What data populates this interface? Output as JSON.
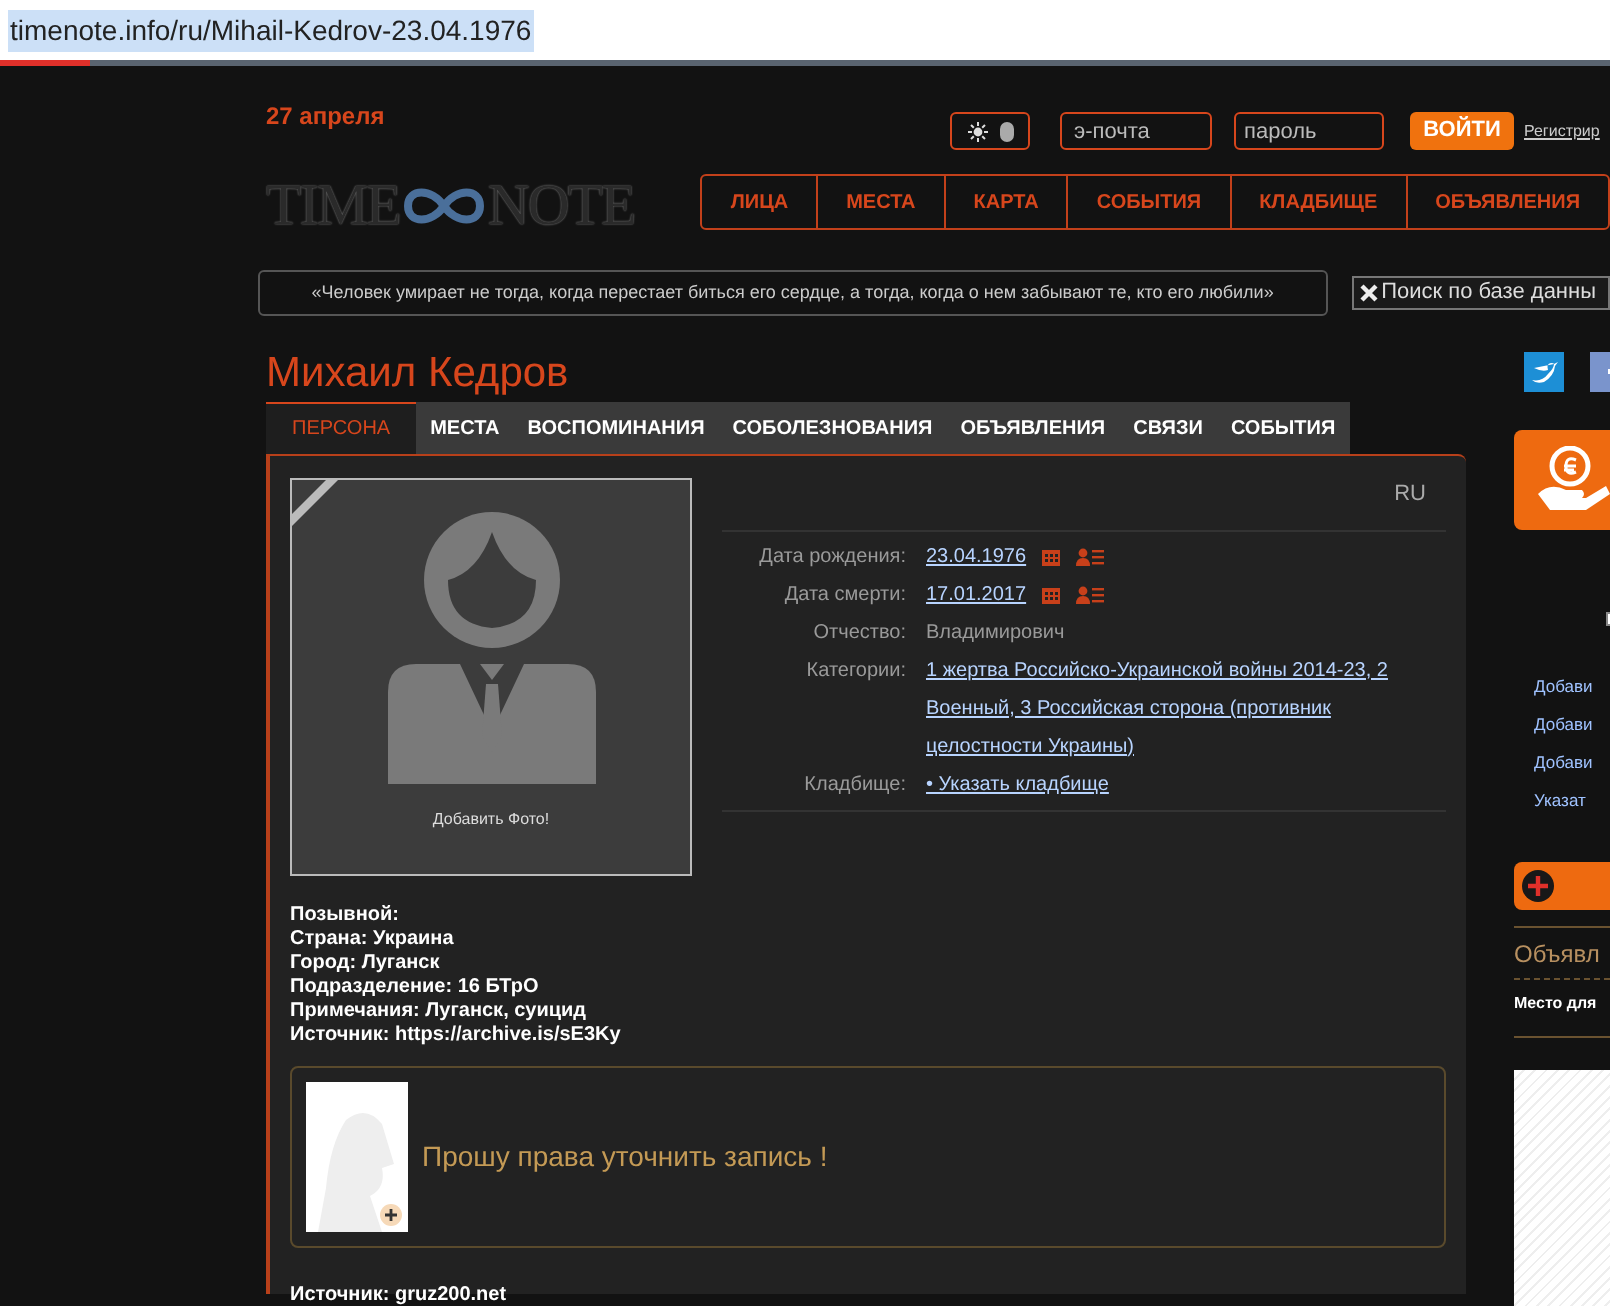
{
  "address_bar": {
    "url": "timenote.info/ru/Mihail-Kedrov-23.04.1976"
  },
  "header": {
    "date": "27 апреля",
    "theme_toggle": {
      "dark": true
    },
    "email": {
      "placeholder": "э-почта"
    },
    "password": {
      "placeholder": "пароль"
    },
    "login_button": "ВОЙТИ",
    "register_link": "Регистрир"
  },
  "logo": {
    "left": "TIME",
    "right": "NOTE"
  },
  "nav": [
    {
      "label": "ЛИЦА"
    },
    {
      "label": "МЕСТА"
    },
    {
      "label": "КАРТА"
    },
    {
      "label": "СОБЫТИЯ"
    },
    {
      "label": "КЛАДБИЩЕ"
    },
    {
      "label": "ОБЪЯВЛЕНИЯ"
    }
  ],
  "quote": "«Человек умирает не тогда, когда перестает биться его сердце, а тогда, когда о нем забывают те, кто его любили»",
  "search_button": "Поиск по базе данны",
  "person": {
    "name": "Михаил Кедров",
    "tabs": [
      {
        "label": "ПЕРСОНА",
        "selected": true
      },
      {
        "label": "МЕСТА",
        "selected": false
      },
      {
        "label": "ВОСПОМИНАНИЯ",
        "selected": false
      },
      {
        "label": "СОБОЛЕЗНОВАНИЯ",
        "selected": false
      },
      {
        "label": "ОБЪЯВЛЕНИЯ",
        "selected": false
      },
      {
        "label": "СВЯЗИ",
        "selected": false
      },
      {
        "label": "СОБЫТИЯ",
        "selected": false
      }
    ],
    "language": "RU",
    "add_photo": "Добавить Фото!",
    "fields": [
      {
        "kind": "date",
        "label": "Дата рождения:",
        "links": [
          "23.04.1976"
        ]
      },
      {
        "kind": "date",
        "label": "Дата смерти:",
        "links": [
          "17.01.2017"
        ]
      },
      {
        "kind": "text",
        "label": "Отчество:",
        "value": "Владимирович"
      },
      {
        "kind": "paragraph",
        "label": "Категории:",
        "value": "1 жертва Российско-Украинской войны 2014-23, 2 Военный, 3 Российская сторона (противник целостности Украины)"
      },
      {
        "kind": "links",
        "label": "Кладбище:",
        "links": [
          "• Указать кладбище"
        ]
      }
    ],
    "details": [
      "Позывной:",
      "Страна: Украина",
      "Город: Луганск",
      "Подразделение: 16 БТрО",
      "Примечания: Луганск, суицид",
      "Источник: https://archive.is/sE3Ky"
    ],
    "notice": "Прошу права уточнить запись !",
    "source": "Источник: gruz200.net"
  },
  "sidebar": {
    "links": [
      "Добави",
      "Добави",
      "Добави",
      "Указат"
    ],
    "ads_title": "Объявл",
    "ads_text": "Место для"
  }
}
